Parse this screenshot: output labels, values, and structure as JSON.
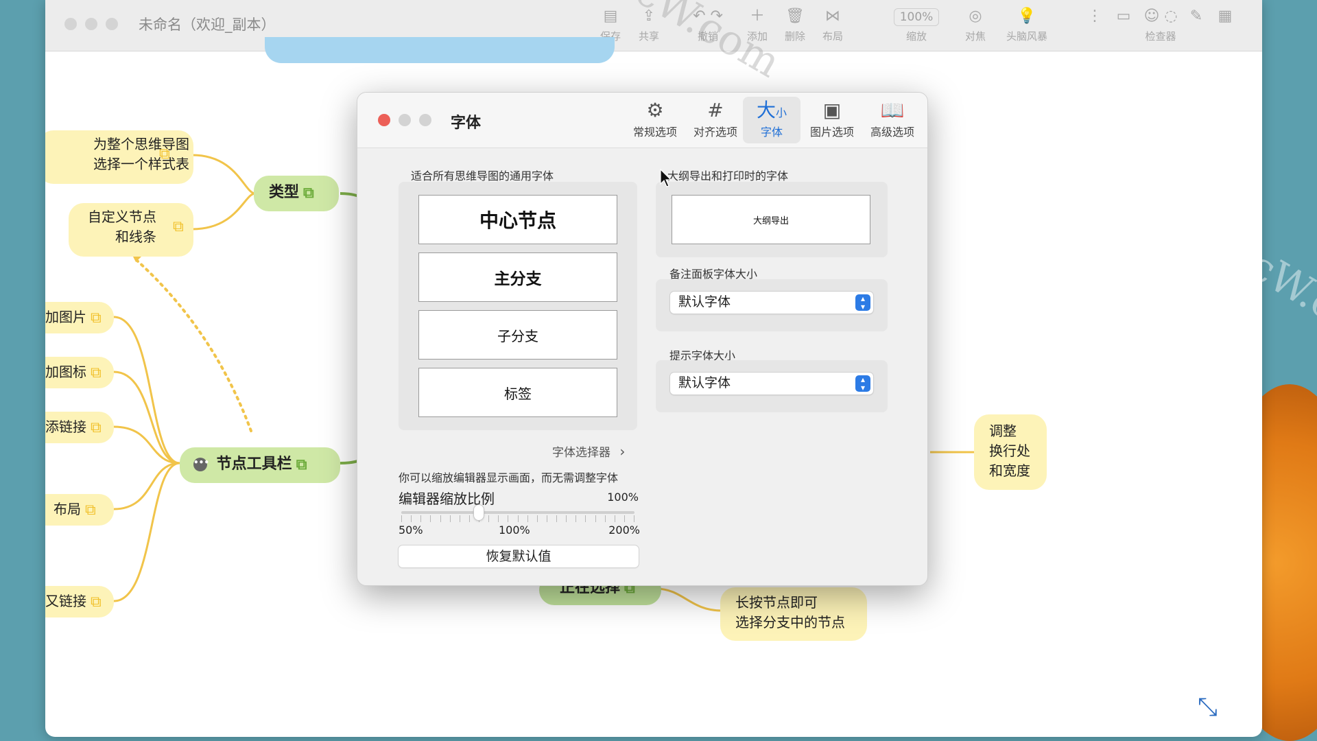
{
  "window": {
    "title": "未命名（欢迎_副本）"
  },
  "toolbar": {
    "save": "保存",
    "share": "共享",
    "undo": "撤销",
    "add": "添加",
    "delete": "删除",
    "layout": "布局",
    "zoom_value": "100%",
    "zoom": "缩放",
    "focus": "对焦",
    "brainstorm": "头脑风暴",
    "inspector": "检查器"
  },
  "mindmap": {
    "node_stylesheet": [
      "为整个思维导图",
      "选择一个样式表"
    ],
    "node_custom": [
      "自定义节点",
      "和线条"
    ],
    "node_type": "类型",
    "node_toolbar": "节点工具栏",
    "left_items": [
      "加图片",
      "加图标",
      "添链接",
      "布局",
      "又链接"
    ],
    "node_select": "正在选择",
    "node_longpress": [
      "长按节点即可",
      "选择分支中的节点"
    ],
    "node_adjust": [
      "调整",
      "换行处",
      "和宽度"
    ]
  },
  "watermark": "MacW.com",
  "dialog": {
    "title": "字体",
    "tabs": [
      {
        "icon": "gears-icon",
        "label": "常规选项"
      },
      {
        "icon": "grid-icon",
        "label": "对齐选项"
      },
      {
        "icon": "font-size-icon",
        "label": "字体",
        "glyph_big": "大",
        "glyph_small": "小"
      },
      {
        "icon": "image-icon",
        "label": "图片选项"
      },
      {
        "icon": "book-icon",
        "label": "高级选项"
      }
    ],
    "general_fonts_label": "适合所有思维导图的通用字体",
    "general_fonts": [
      "中心节点",
      "主分支",
      "子分支",
      "标签"
    ],
    "outline_label": "大纲导出和打印时的字体",
    "outline_font": "大纲导出",
    "notes_label": "备注面板字体大小",
    "notes_value": "默认字体",
    "hint_label": "提示字体大小",
    "hint_value": "默认字体",
    "font_picker": "字体选择器",
    "zoom_note": "你可以缩放编辑器显示画面，而无需调整字体",
    "zoom_label": "编辑器缩放比例",
    "zoom_value": "100%",
    "zoom_fraction": 0.333,
    "zoom_ticks": [
      "50%",
      "100%",
      "200%"
    ],
    "reset": "恢复默认值"
  },
  "colors": {
    "accent": "#1f6fd6",
    "close": "#ec5f57",
    "node_yellow": "#fdf3b8",
    "node_green": "#cfe8a6",
    "line": "#f1c44a"
  }
}
